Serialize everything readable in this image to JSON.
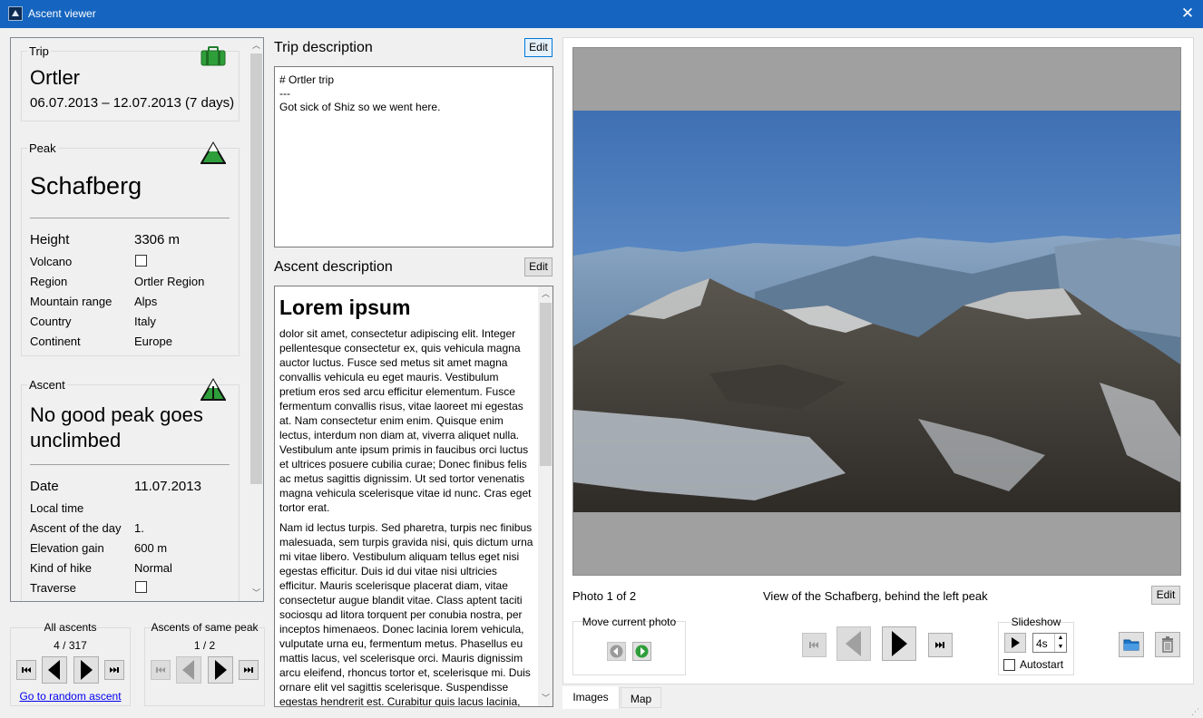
{
  "window": {
    "title": "Ascent viewer"
  },
  "trip": {
    "group_label": "Trip",
    "name": "Ortler",
    "dates": "06.07.2013 – 12.07.2013 (7 days)"
  },
  "peak": {
    "group_label": "Peak",
    "name": "Schafberg",
    "height_label": "Height",
    "height": "3306 m",
    "volcano_label": "Volcano",
    "region_label": "Region",
    "region": "Ortler Region",
    "range_label": "Mountain range",
    "range": "Alps",
    "country_label": "Country",
    "country": "Italy",
    "continent_label": "Continent",
    "continent": "Europe"
  },
  "ascent": {
    "group_label": "Ascent",
    "title_line1": "No good peak goes",
    "title_line2": "unclimbed",
    "date_label": "Date",
    "date": "11.07.2013",
    "localtime_label": "Local time",
    "ascentofday_label": "Ascent of the day",
    "ascentofday": "1.",
    "gain_label": "Elevation gain",
    "gain": "600 m",
    "kind_label": "Kind of hike",
    "kind": "Normal",
    "traverse_label": "Traverse"
  },
  "nav": {
    "all_label": "All ascents",
    "all_count": "4 / 317",
    "same_label": "Ascents of same peak",
    "same_count": "1 / 2",
    "random_link": "Go to random ascent"
  },
  "trip_description": {
    "title": "Trip description",
    "edit": "Edit",
    "line1": "# Ortler trip",
    "line2": "---",
    "line3": "Got sick of Shiz so we went here."
  },
  "ascent_description": {
    "title": "Ascent description",
    "edit": "Edit",
    "heading": "Lorem ipsum",
    "para1": "dolor sit amet, consectetur adipiscing elit. Integer pellentesque consectetur ex, quis vehicula magna auctor luctus. Fusce sed metus sit amet magna convallis vehicula eu eget mauris. Vestibulum pretium eros sed arcu efficitur elementum. Fusce fermentum convallis risus, vitae laoreet mi egestas at. Nam consectetur enim enim. Quisque enim lectus, interdum non diam at, viverra aliquet nulla. Vestibulum ante ipsum primis in faucibus orci luctus et ultrices posuere cubilia curae; Donec finibus felis ac metus sagittis dignissim. Ut sed tortor venenatis magna vehicula scelerisque vitae id nunc. Cras eget tortor erat.",
    "para2": "Nam id lectus turpis. Sed pharetra, turpis nec finibus malesuada, sem turpis gravida nisi, quis dictum urna mi vitae libero. Vestibulum aliquam tellus eget nisi egestas efficitur. Duis id dui vitae nisi ultricies efficitur. Mauris scelerisque placerat diam, vitae consectetur augue blandit vitae. Class aptent taciti sociosqu ad litora torquent per conubia nostra, per inceptos himenaeos. Donec lacinia lorem vehicula, vulputate urna eu, fermentum metus. Phasellus eu mattis lacus, vel scelerisque orci. Mauris dignissim arcu eleifend, rhoncus tortor et, scelerisque mi. Duis ornare elit vel sagittis scelerisque. Suspendisse egestas hendrerit est. Curabitur quis lacus lacinia,"
  },
  "photo": {
    "counter": "Photo 1 of 2",
    "caption": "View of the Schafberg, behind the left peak",
    "edit": "Edit",
    "move_label": "Move current photo",
    "slideshow_label": "Slideshow",
    "interval": "4s",
    "autostart_label": "Autostart"
  },
  "tabs": [
    {
      "label": "Images"
    },
    {
      "label": "Map"
    }
  ],
  "icons": {
    "trip": "suitcase-icon",
    "peak": "mountain-icon",
    "ascent": "flag-mountain-icon",
    "folder": "folder-icon",
    "trash": "trash-icon"
  },
  "colors": {
    "titlebar": "#1565c0",
    "accent_green": "#2e9e3a",
    "link": "#0000ee"
  }
}
